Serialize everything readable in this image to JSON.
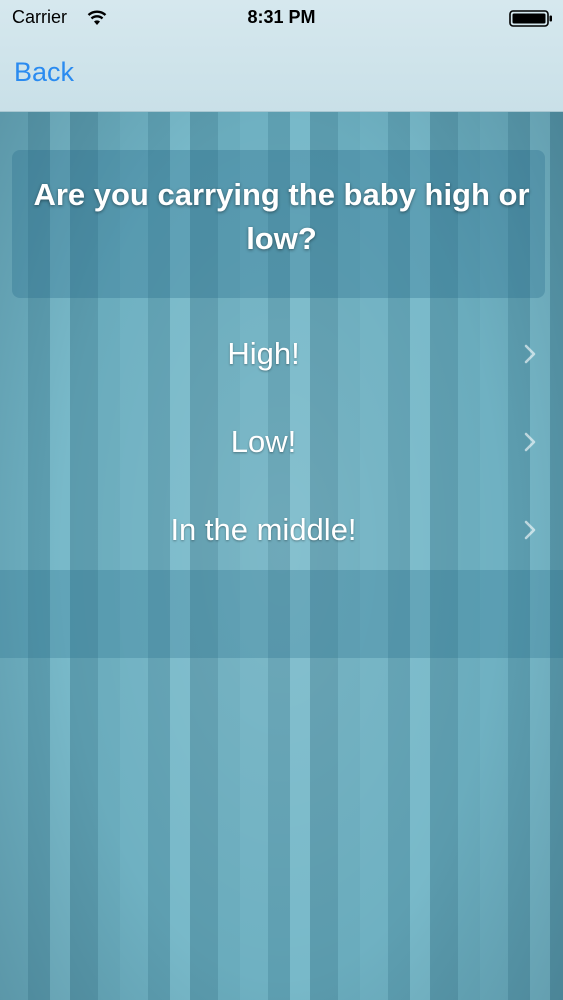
{
  "status_bar": {
    "carrier": "Carrier",
    "time": "8:31 PM"
  },
  "nav": {
    "back_label": "Back"
  },
  "question": {
    "text": "Are you carrying the baby high or low?"
  },
  "options": [
    {
      "label": "High!"
    },
    {
      "label": "Low!"
    },
    {
      "label": "In the middle!"
    }
  ],
  "colors": {
    "accent": "#2a8bf0",
    "background": "#6aacbd"
  },
  "icons": {
    "wifi": "wifi-icon",
    "battery": "battery-icon",
    "chevron": "chevron-right-icon"
  }
}
